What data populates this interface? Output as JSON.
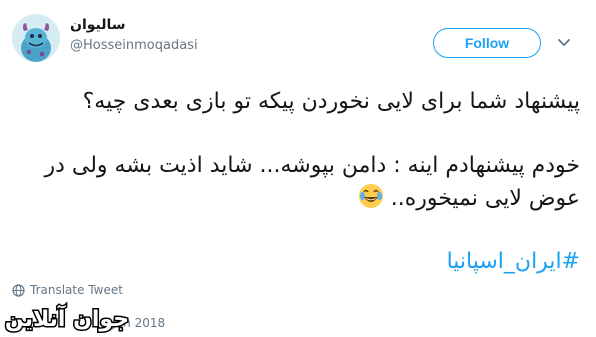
{
  "author": {
    "display_name": "سالیوان",
    "handle": "@Hosseinmoqadasi"
  },
  "follow_label": "Follow",
  "tweet": {
    "line1": "پیشنهاد شما برای لایی نخوردن پیکه تو بازی بعدی چیه؟",
    "line2": "خودم پیشنهادم اینه : دامن بپوشه... شاید اذیت بشه ولی در",
    "line3": "عوض لایی نمیخوره..",
    "hashtag": "#ایران_اسپانیا"
  },
  "translate_label": "Translate Tweet",
  "date_text": "Jun 2018",
  "watermark_text": "جوان آنلاین",
  "colors": {
    "accent": "#1da1f2",
    "muted": "#657786",
    "text": "#14171a"
  },
  "icons": [
    "avatar-image",
    "chevron-down-icon",
    "globe-icon",
    "laughing-emoji-icon"
  ]
}
